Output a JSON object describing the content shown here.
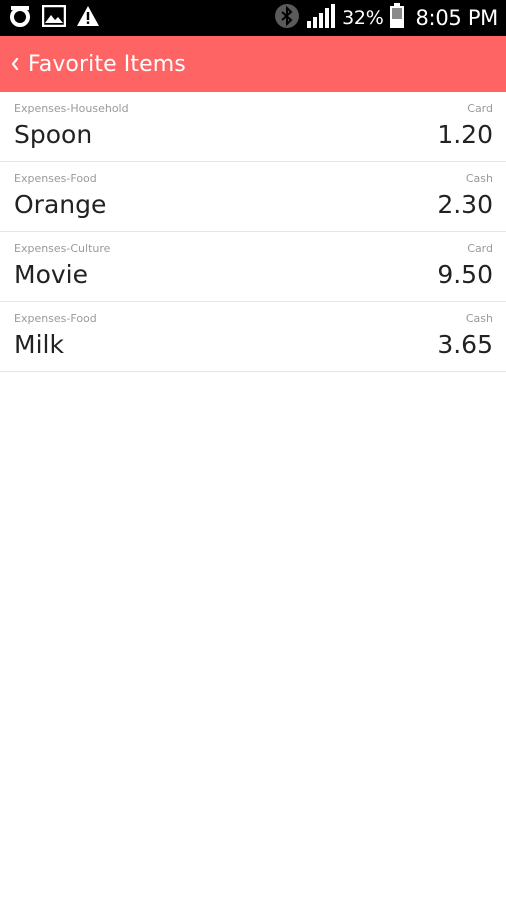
{
  "status_bar": {
    "battery_percent": "32%",
    "time": "8:05 PM",
    "icons_left": [
      "app-o-icon",
      "image-icon",
      "warning-icon"
    ],
    "icons_right": [
      "bluetooth-icon",
      "signal-icon",
      "battery-icon"
    ]
  },
  "app_bar": {
    "title": "Favorite Items",
    "back_icon": "chevron-left-icon",
    "color": "#ff6464"
  },
  "items": [
    {
      "category": "Expenses-Household",
      "payment": "Card",
      "name": "Spoon",
      "amount": "1.20"
    },
    {
      "category": "Expenses-Food",
      "payment": "Cash",
      "name": "Orange",
      "amount": "2.30"
    },
    {
      "category": "Expenses-Culture",
      "payment": "Card",
      "name": "Movie",
      "amount": "9.50"
    },
    {
      "category": "Expenses-Food",
      "payment": "Cash",
      "name": "Milk",
      "amount": "3.65"
    }
  ]
}
